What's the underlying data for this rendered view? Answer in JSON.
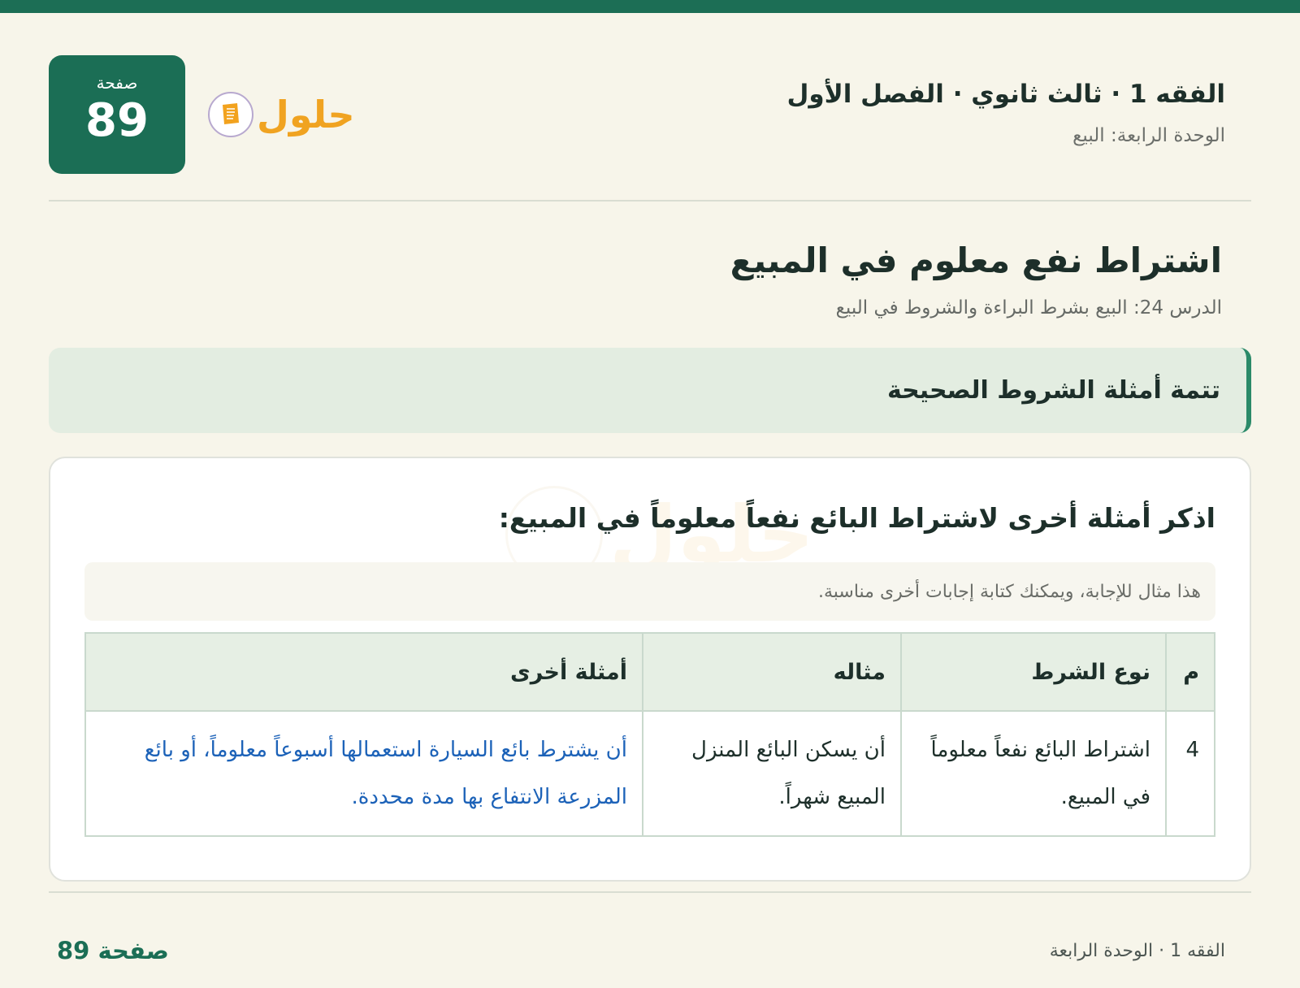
{
  "header": {
    "course_title": "الفقه 1 · ثالث ثانوي · الفصل الأول",
    "unit_title": "الوحدة الرابعة: البيع",
    "page_label": "صفحة",
    "page_number": "89",
    "logo_text": "حلول"
  },
  "lesson": {
    "title": "اشتراط نفع معلوم في المبيع",
    "subtitle": "الدرس 24: البيع بشرط البراءة والشروط في البيع"
  },
  "section": {
    "title": "تتمة أمثلة الشروط الصحيحة"
  },
  "question": {
    "text": "اذكر أمثلة أخرى لاشتراط البائع نفعاً معلوماً في المبيع:",
    "note": "هذا مثال للإجابة، ويمكنك كتابة إجابات أخرى مناسبة."
  },
  "table": {
    "headers": [
      "م",
      "نوع الشرط",
      "مثاله",
      "أمثلة أخرى"
    ],
    "rows": [
      [
        "4",
        "اشتراط البائع نفعاً معلوماً في المبيع.",
        "أن يسكن البائع المنزل المبيع شهراً.",
        "أن يشترط بائع السيارة استعمالها أسبوعاً معلوماً، أو بائع المزرعة الانتفاع بها مدة محددة."
      ]
    ]
  },
  "footer": {
    "left_text": "الفقه 1 · الوحدة الرابعة",
    "page_text": "صفحة 89"
  },
  "colors": {
    "accent": "#1b6e55",
    "answer_text": "#1c62b8",
    "background": "#f7f5ea"
  }
}
